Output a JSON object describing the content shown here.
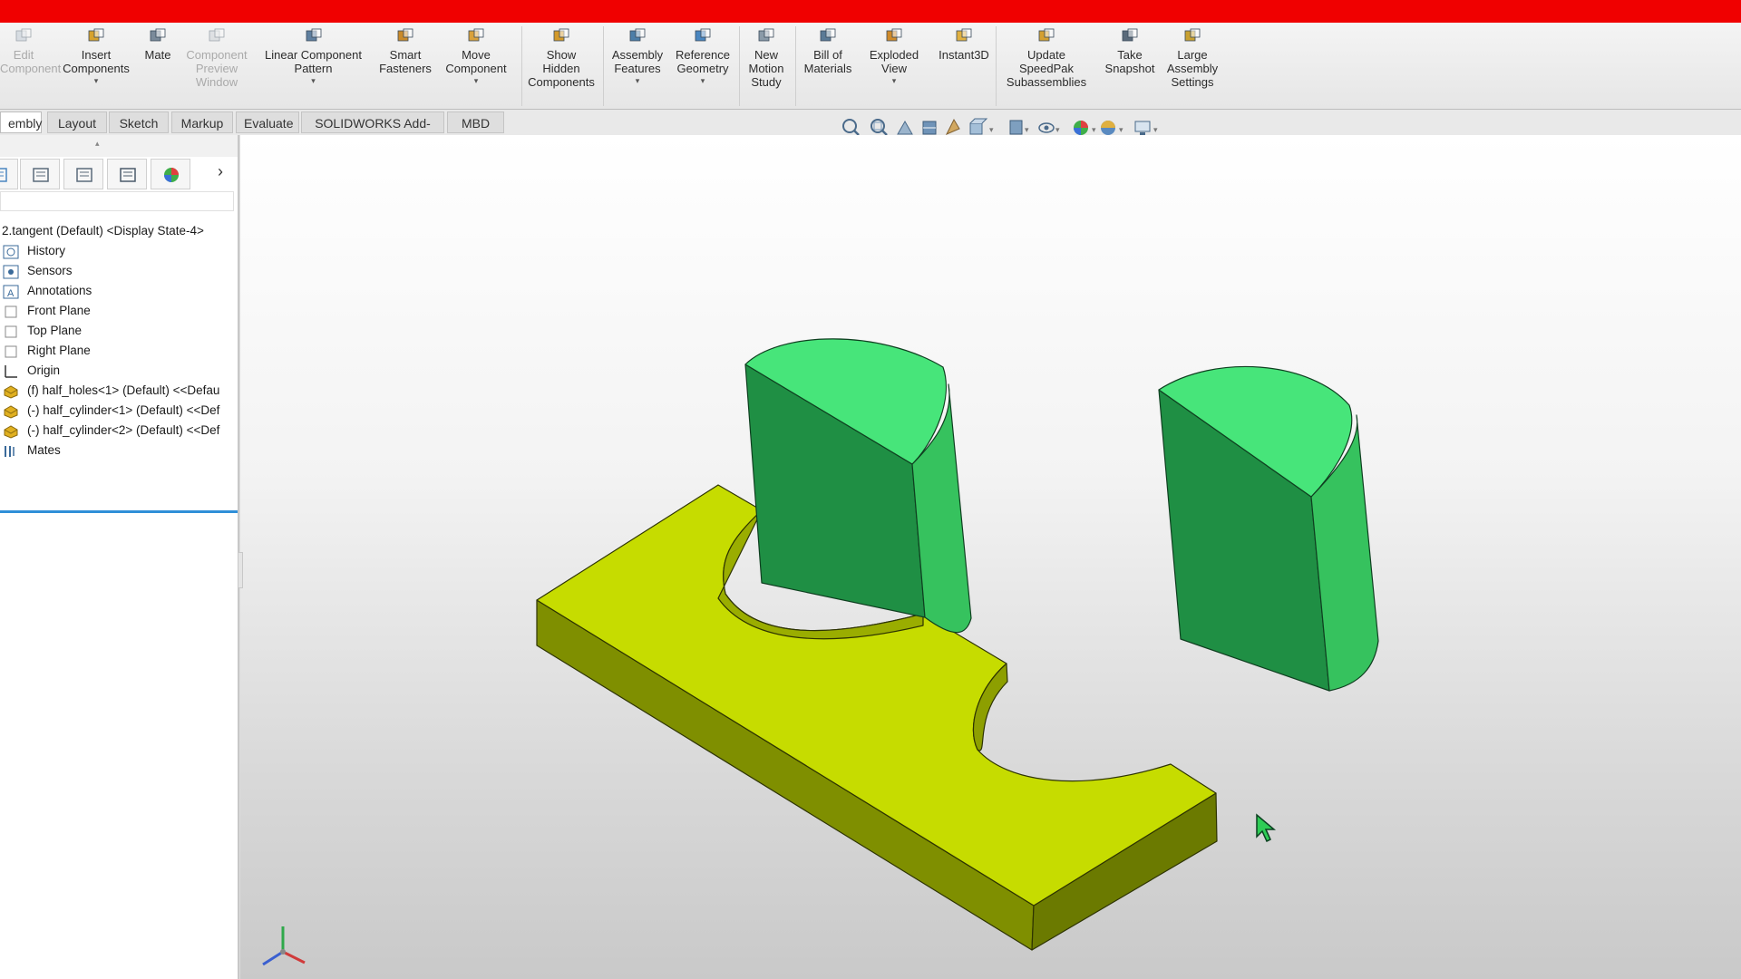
{
  "ribbon": {
    "buttons": [
      {
        "label": "Edit\nComponent",
        "icon": "edit-component-icon",
        "dim": true
      },
      {
        "label": "Insert\nComponents",
        "icon": "insert-components-icon",
        "dropdown": true
      },
      {
        "label": "Mate",
        "icon": "mate-icon"
      },
      {
        "label": "Component\nPreview\nWindow",
        "icon": "component-preview-icon",
        "dim": true
      },
      {
        "label": "Linear Component\nPattern",
        "icon": "linear-pattern-icon",
        "dropdown": true
      },
      {
        "label": "Smart\nFasteners",
        "icon": "smart-fasteners-icon"
      },
      {
        "label": "Move\nComponent",
        "icon": "move-component-icon",
        "dropdown": true
      },
      {
        "label": "Show\nHidden\nComponents",
        "icon": "show-hidden-icon"
      },
      {
        "label": "Assembly\nFeatures",
        "icon": "assembly-features-icon",
        "dropdown": true
      },
      {
        "label": "Reference\nGeometry",
        "icon": "reference-geometry-icon",
        "dropdown": true
      },
      {
        "label": "New\nMotion\nStudy",
        "icon": "motion-study-icon"
      },
      {
        "label": "Bill of\nMaterials",
        "icon": "bill-of-materials-icon"
      },
      {
        "label": "Exploded\nView",
        "icon": "exploded-view-icon",
        "dropdown": true
      },
      {
        "label": "Instant3D",
        "icon": "instant3d-icon"
      },
      {
        "label": "Update\nSpeedPak\nSubassemblies",
        "icon": "speedpak-icon"
      },
      {
        "label": "Take\nSnapshot",
        "icon": "camera-icon"
      },
      {
        "label": "Large\nAssembly\nSettings",
        "icon": "large-assembly-icon"
      }
    ]
  },
  "tabs": [
    "embly",
    "Layout",
    "Sketch",
    "Markup",
    "Evaluate",
    "SOLIDWORKS Add-Ins",
    "MBD"
  ],
  "panel": {
    "root": "2.tangent (Default) <Display State-4>",
    "items": [
      {
        "label": "History",
        "icon": "history-icon"
      },
      {
        "label": "Sensors",
        "icon": "sensors-icon"
      },
      {
        "label": "Annotations",
        "icon": "annotations-icon"
      },
      {
        "label": "Front Plane",
        "icon": "plane-icon"
      },
      {
        "label": "Top Plane",
        "icon": "plane-icon"
      },
      {
        "label": "Right Plane",
        "icon": "plane-icon"
      },
      {
        "label": "Origin",
        "icon": "origin-icon"
      },
      {
        "label": "(f) half_holes<1> (Default) <<Defau",
        "icon": "part-icon"
      },
      {
        "label": "(-) half_cylinder<1> (Default) <<Def",
        "icon": "part-icon"
      },
      {
        "label": "(-) half_cylinder<2> (Default) <<Def",
        "icon": "part-icon"
      },
      {
        "label": "Mates",
        "icon": "mates-icon"
      }
    ]
  },
  "colors": {
    "title_bar": "#f00000",
    "plate": "#c8dc00",
    "cylinder": "#3fd46a",
    "accent": "#2f8fd8"
  }
}
